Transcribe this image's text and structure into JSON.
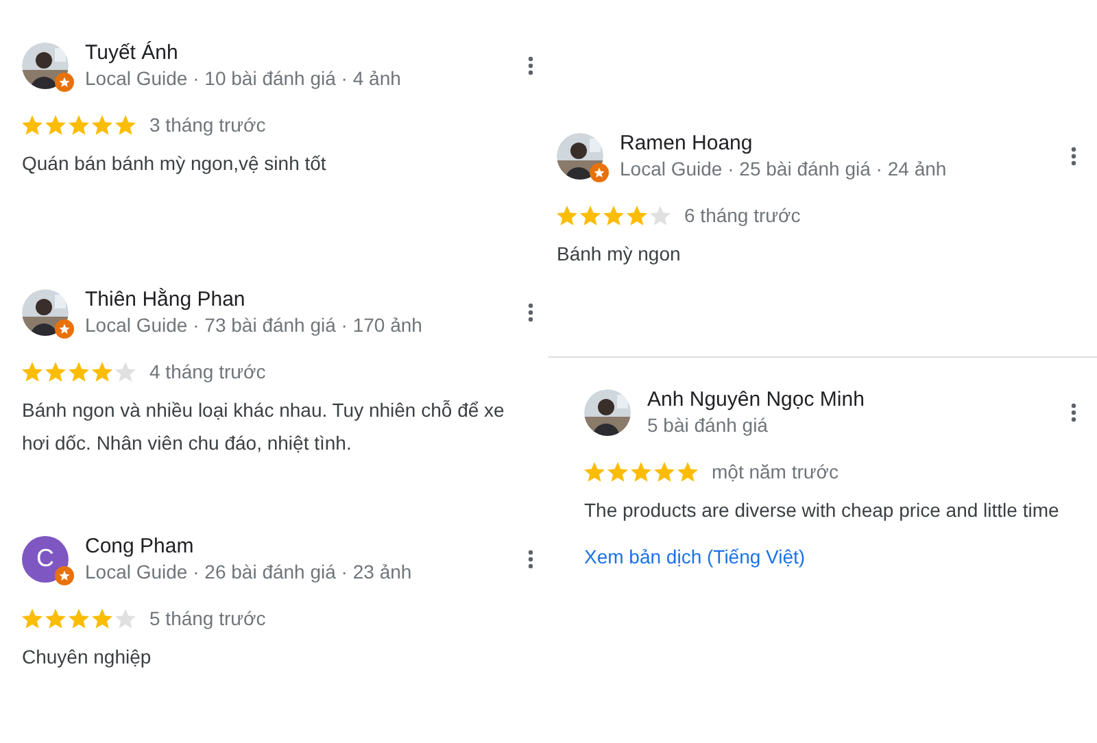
{
  "columns": [
    {
      "reviews": [
        {
          "local_guide": true,
          "name": "Tuyết Ánh",
          "meta": "Local Guide · 10 bài đánh giá · 4 ảnh",
          "stars": 5,
          "time": "3 tháng trước",
          "text": "Quán bán bánh mỳ ngon,vệ sinh tốt"
        },
        {
          "local_guide": true,
          "name": "Thiên Hằng Phan",
          "meta": "Local Guide · 73 bài đánh giá · 170 ảnh",
          "stars": 4,
          "time": "4 tháng trước",
          "text": "Bánh ngon và nhiều loại khác nhau. Tuy nhiên chỗ để xe hơi dốc. Nhân viên chu đáo, nhiệt tình."
        },
        {
          "avatar": {
            "kind": "letter",
            "letter": "C",
            "color": "#7e57c2"
          },
          "local_guide": true,
          "name": "Cong Pham",
          "meta": "Local Guide · 26 bài đánh giá · 23 ảnh",
          "stars": 4,
          "time": "5 tháng trước",
          "text": "Chuyên nghiệp"
        }
      ]
    },
    {
      "reviews": [
        {
          "local_guide": true,
          "name": "Ramen Hoang",
          "meta": "Local Guide · 25 bài đánh giá · 24 ảnh",
          "stars": 4,
          "time": "6 tháng trước",
          "text": "Bánh mỳ ngon"
        },
        {
          "local_guide": false,
          "name": "Anh Nguyên Ngọc Minh",
          "meta": "5 bài đánh giá",
          "stars": 5,
          "time": "một năm trước",
          "text": "The products are diverse with cheap price and little time",
          "link": "Xem bản dịch (Tiếng Việt)"
        }
      ]
    }
  ]
}
